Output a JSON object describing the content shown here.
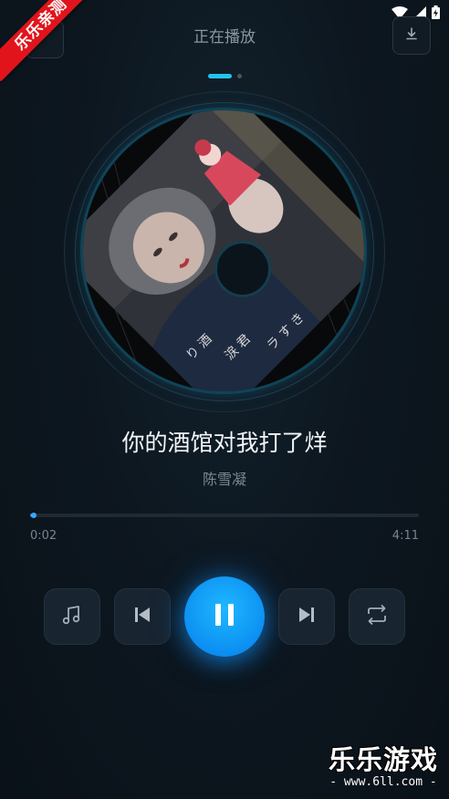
{
  "watermark_ribbon": "乐乐亲测",
  "header": {
    "title": "正在播放",
    "back_icon": "back-icon",
    "download_icon": "download-icon"
  },
  "pager": {
    "pages": 2,
    "active_index": 0
  },
  "album": {
    "art_description_icon": "album-cover-art"
  },
  "song": {
    "title": "你的酒馆对我打了烊",
    "artist": "陈雪凝"
  },
  "progress": {
    "elapsed": "0:02",
    "total": "4:11",
    "fraction": 0.008
  },
  "controls": {
    "playlist_icon": "music-note-icon",
    "previous_icon": "skip-previous-icon",
    "play_pause_icon": "pause-icon",
    "next_icon": "skip-next-icon",
    "repeat_icon": "repeat-icon"
  },
  "colors": {
    "accent": "#21c4ec",
    "play_button": "#0c8ff2",
    "background": "#0c141c",
    "ribbon": "#e1141b"
  },
  "site_watermark": {
    "main": "乐乐游戏",
    "sub": "- www.6ll.com -"
  }
}
